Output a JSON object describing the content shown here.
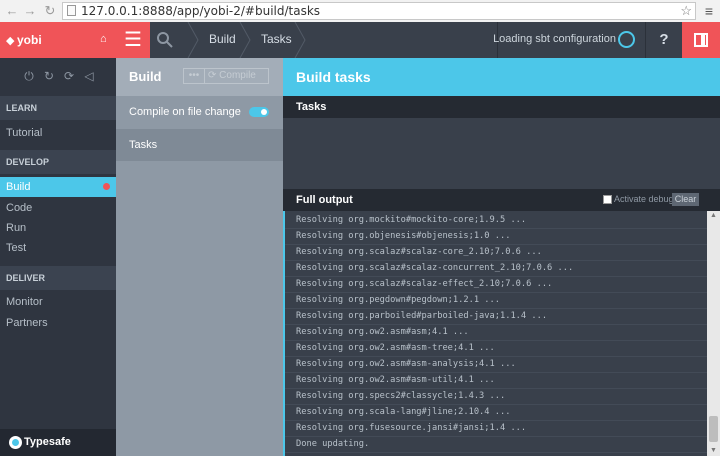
{
  "browser": {
    "url": "127.0.0.1:8888/app/yobi-2/#build/tasks"
  },
  "app": {
    "project_name": "yobi",
    "breadcrumbs": [
      "Build",
      "Tasks"
    ],
    "status_text": "Loading sbt configuration",
    "help_label": "?",
    "brand_name": "Typesafe"
  },
  "sidebar": {
    "sections": [
      {
        "title": "LEARN",
        "items": [
          "Tutorial"
        ]
      },
      {
        "title": "DEVELOP",
        "items": [
          "Build",
          "Code",
          "Run",
          "Test"
        ]
      },
      {
        "title": "DELIVER",
        "items": [
          "Monitor",
          "Partners"
        ]
      }
    ],
    "active_item": "Build"
  },
  "build_panel": {
    "title": "Build",
    "compile_button": "Compile",
    "compile_on_change_label": "Compile on file change",
    "compile_on_change_enabled": true,
    "tasks_label": "Tasks"
  },
  "content": {
    "title": "Build tasks",
    "tasks_header": "Tasks",
    "output_header": "Full output",
    "activate_debug_label": "Activate debug",
    "clear_label": "Clear",
    "log_lines": [
      "Resolving org.mockito#mockito-core;1.9.5 ...",
      "Resolving org.objenesis#objenesis;1.0 ...",
      "Resolving org.scalaz#scalaz-core_2.10;7.0.6 ...",
      "Resolving org.scalaz#scalaz-concurrent_2.10;7.0.6 ...",
      "Resolving org.scalaz#scalaz-effect_2.10;7.0.6 ...",
      "Resolving org.pegdown#pegdown;1.2.1 ...",
      "Resolving org.parboiled#parboiled-java;1.1.4 ...",
      "Resolving org.ow2.asm#asm;4.1 ...",
      "Resolving org.ow2.asm#asm-tree;4.1 ...",
      "Resolving org.ow2.asm#asm-analysis;4.1 ...",
      "Resolving org.ow2.asm#asm-util;4.1 ...",
      "Resolving org.specs2#classycle;1.4.3 ...",
      "Resolving org.scala-lang#jline;2.10.4 ...",
      "Resolving org.fusesource.jansi#jansi;1.4 ...",
      "Done updating."
    ]
  },
  "colors": {
    "accent_red": "#f05458",
    "accent_cyan": "#4cc7e9",
    "dark_bg": "#2f3540"
  }
}
